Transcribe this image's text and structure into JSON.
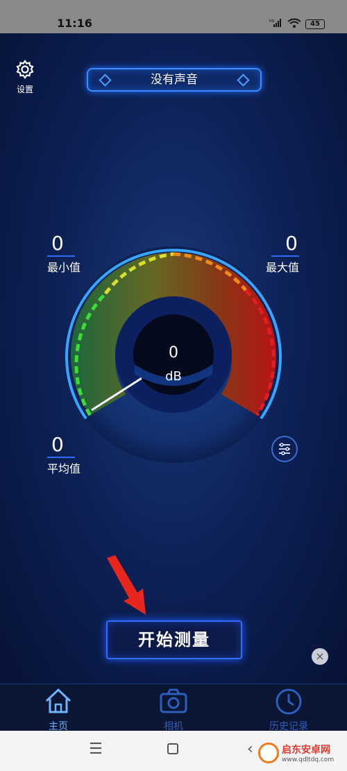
{
  "status_bar": {
    "time": "11:16",
    "battery": "45"
  },
  "header": {
    "settings_label": "设置",
    "mode_label": "没有声音"
  },
  "stats": {
    "min": {
      "value": "0",
      "label": "最小值"
    },
    "max": {
      "value": "0",
      "label": "最大值"
    },
    "avg": {
      "value": "0",
      "label": "平均值"
    }
  },
  "gauge": {
    "value": "0",
    "unit": "dB",
    "needle_level": 0
  },
  "actions": {
    "start_label": "开始测量",
    "close_symbol": "×"
  },
  "bottom_nav": [
    {
      "label": "主页",
      "icon": "home-icon",
      "active": true
    },
    {
      "label": "相机",
      "icon": "camera-icon",
      "active": false
    },
    {
      "label": "历史记录",
      "icon": "clock-icon",
      "active": false
    }
  ],
  "watermark": {
    "title": "启东安卓网",
    "url": "www.qdltdq.com"
  },
  "colors": {
    "accent": "#3a8cff",
    "active_tab": "#6fb4ff",
    "inactive_tab": "#2d5fbf",
    "arrow": "#e8261d"
  }
}
